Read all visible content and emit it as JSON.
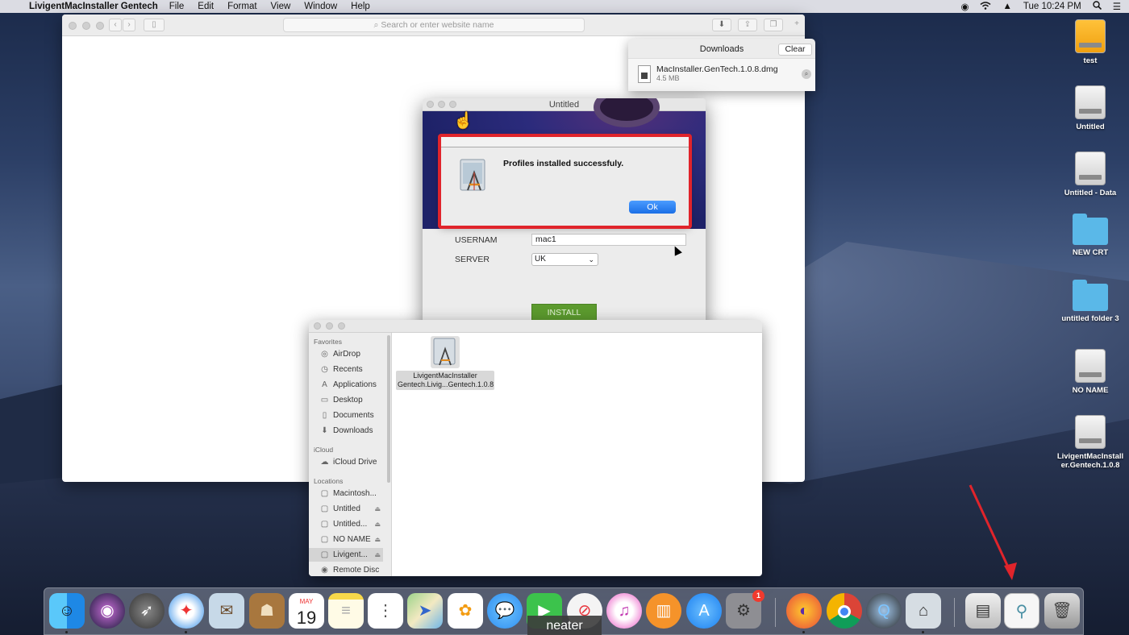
{
  "menubar": {
    "apple_icon": "apple-logo-icon",
    "app_name": "LivigentMacInstaller Gentech",
    "items": [
      "File",
      "Edit",
      "Format",
      "View",
      "Window",
      "Help"
    ],
    "clock": "Tue 10:24 PM"
  },
  "safari": {
    "address_placeholder": "Search or enter website name"
  },
  "downloads": {
    "title": "Downloads",
    "clear_label": "Clear",
    "file_name": "MacInstaller.GenTech.1.0.8.dmg",
    "file_size": "4.5 MB"
  },
  "installer": {
    "title": "Untitled",
    "username_label": "USERNAM",
    "username_value": "mac1",
    "server_label": "SERVER",
    "server_value": "UK",
    "install_label": "INSTALL"
  },
  "alert": {
    "message": "Profiles installed successfuly.",
    "ok_label": "Ok",
    "highlight_color": "#e0242b"
  },
  "finder": {
    "favorites_header": "Favorites",
    "favorites": [
      {
        "label": "AirDrop",
        "icon": "airdrop-icon"
      },
      {
        "label": "Recents",
        "icon": "clock-icon"
      },
      {
        "label": "Applications",
        "icon": "applications-icon"
      },
      {
        "label": "Desktop",
        "icon": "desktop-icon"
      },
      {
        "label": "Documents",
        "icon": "document-icon"
      },
      {
        "label": "Downloads",
        "icon": "download-icon"
      }
    ],
    "icloud_header": "iCloud",
    "icloud": [
      {
        "label": "iCloud Drive",
        "icon": "cloud-icon"
      }
    ],
    "locations_header": "Locations",
    "locations": [
      {
        "label": "Macintosh...",
        "icon": "disk-icon"
      },
      {
        "label": "Untitled",
        "icon": "disk-icon"
      },
      {
        "label": "Untitled...",
        "icon": "disk-icon"
      },
      {
        "label": "NO NAME",
        "icon": "disk-icon"
      },
      {
        "label": "Livigent...",
        "icon": "disk-icon"
      },
      {
        "label": "Remote Disc",
        "icon": "disc-icon"
      }
    ],
    "file_line1": "LivigentMacInstaller",
    "file_line2": "Gentech.Livig...Gentech.1.0.8"
  },
  "desktop": {
    "icons": [
      {
        "label": "test",
        "type": "drive-orange"
      },
      {
        "label": "Untitled",
        "type": "drive"
      },
      {
        "label": "Untitled - Data",
        "type": "drive"
      },
      {
        "label": "NEW CRT",
        "type": "folder"
      },
      {
        "label": "untitled folder 3",
        "type": "folder"
      },
      {
        "label": "NO NAME",
        "type": "drive"
      },
      {
        "label": "LivigentMacInstall er.Gentech.1.0.8",
        "type": "drive"
      }
    ]
  },
  "dock": {
    "tooltip": "neater",
    "system_prefs_badge": "1",
    "calendar_month": "MAY",
    "calendar_day": "19",
    "apps": [
      "Finder",
      "Siri",
      "Launchpad",
      "Safari",
      "Mail",
      "Contacts",
      "Calendar",
      "Notes",
      "Reminders",
      "Maps",
      "Photos",
      "Messages",
      "FaceTime",
      "News",
      "iTunes",
      "Books",
      "App Store",
      "System Preferences",
      "Firefox",
      "Chrome",
      "QuickTime",
      "Installer",
      "Disk",
      "Gentech",
      "Trash"
    ]
  },
  "annotation_color": "#e0242b"
}
